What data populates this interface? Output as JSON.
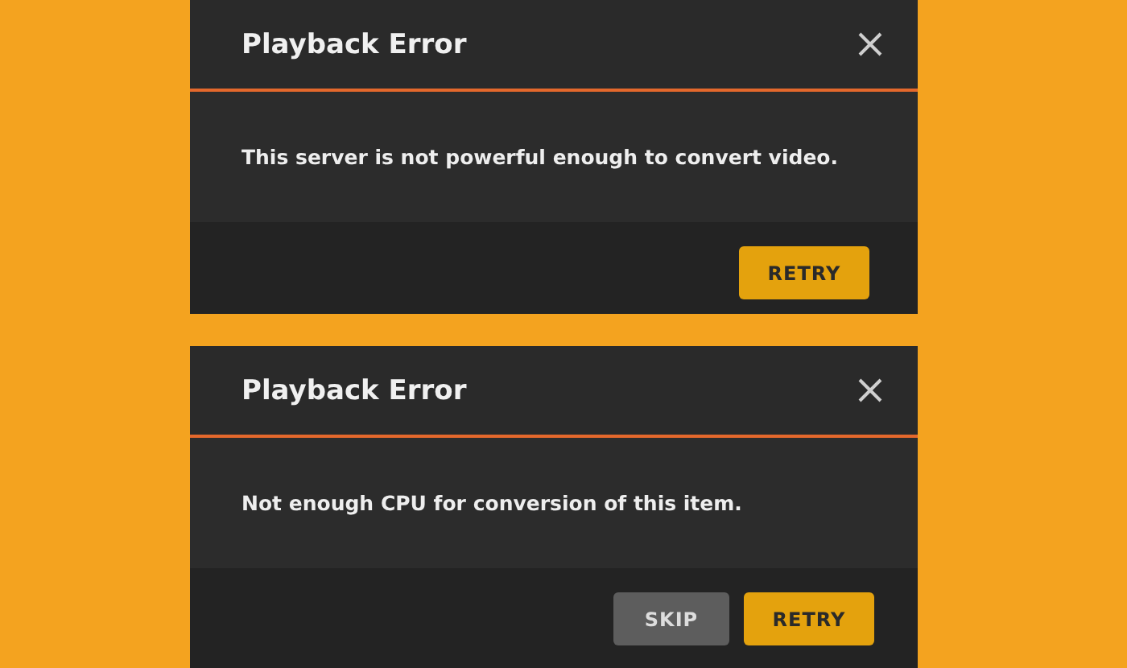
{
  "dialogs": [
    {
      "title": "Playback Error",
      "message": "This server is not powerful enough to convert video.",
      "buttons": [
        {
          "label": "RETRY",
          "kind": "primary"
        }
      ]
    },
    {
      "title": "Playback Error",
      "message": "Not enough CPU for conversion of this item.",
      "buttons": [
        {
          "label": "SKIP",
          "kind": "secondary"
        },
        {
          "label": "RETRY",
          "kind": "primary"
        }
      ]
    }
  ]
}
